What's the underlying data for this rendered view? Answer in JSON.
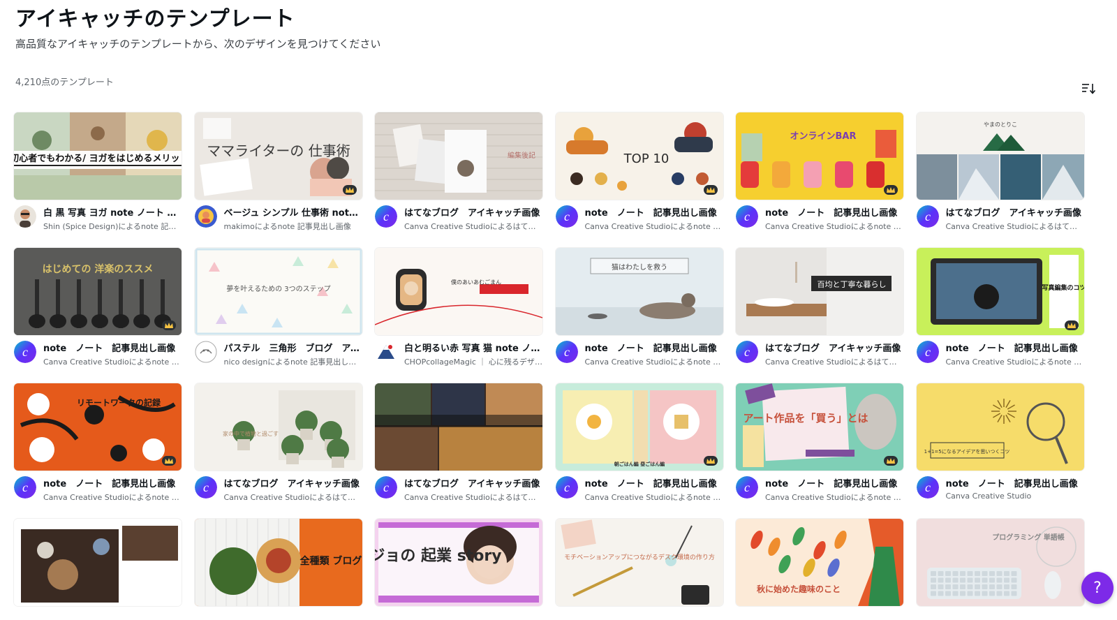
{
  "header": {
    "title": "アイキャッチのテンプレート",
    "subtitle": "高品質なアイキャッチのテンプレートから、次のデザインを見つけてください",
    "count": "4,210点のテンプレート",
    "sort_icon": "sort-icon"
  },
  "help": {
    "label": "?"
  },
  "templates": [
    {
      "title": "白 黒 写真 ヨガ note ノート 記事見出し画像",
      "author": "Shin (Spice Design)によるnote 記事見出し画像",
      "thumb_text": "\\初心者でもわかる/ ヨガをはじめるメリット",
      "avatar": "person",
      "crown": false
    },
    {
      "title": "ベージュ シンプル 仕事術 note 記事見出し画像",
      "author": "makimoによるnote 記事見出し画像",
      "thumb_text": "ママライターの 仕事術",
      "avatar": "creator",
      "crown": true
    },
    {
      "title": "はてなブログ　アイキャッチ画像",
      "author": "Canva Creative Studioによるはてなブログ",
      "thumb_text": "編集後記",
      "avatar": "canva",
      "crown": false
    },
    {
      "title": "note　ノート　記事見出し画像",
      "author": "Canva Creative Studioによるnote 記事見出し画像",
      "thumb_text": "TOP 10",
      "avatar": "canva",
      "crown": true
    },
    {
      "title": "note　ノート　記事見出し画像",
      "author": "Canva Creative Studioによるnote 記事見出し画像",
      "thumb_text": "オンラインBAR",
      "avatar": "canva",
      "crown": true
    },
    {
      "title": "はてなブログ　アイキャッチ画像",
      "author": "Canva Creative Studioによるはてなブログ",
      "thumb_text": "やまのとりこ",
      "avatar": "canva",
      "crown": false
    },
    {
      "title": "note　ノート　記事見出し画像",
      "author": "Canva Creative Studioによるnote 記事見出し画像",
      "thumb_text": "はじめての 洋楽のススメ",
      "avatar": "canva",
      "crown": true
    },
    {
      "title": "パステル　三角形　ブログ　アイキャッチ",
      "author": "nico designによるnote 記事見出し画像",
      "thumb_text": "夢を叶えるための 3つのステップ",
      "avatar": "nico",
      "crown": false
    },
    {
      "title": "白と明るい赤 写真 猫 note ノート 記事見出し画像",
      "author": "CHOPcollageMagic ｜ 心に残るデザイン",
      "thumb_text": "僕のあいあむごまん",
      "avatar": "chop",
      "crown": false
    },
    {
      "title": "note　ノート　記事見出し画像",
      "author": "Canva Creative Studioによるnote 記事見出し画像",
      "thumb_text": "猫はわたしを救う",
      "avatar": "canva",
      "crown": false
    },
    {
      "title": "はてなブログ　アイキャッチ画像",
      "author": "Canva Creative Studioによるはてなブログ",
      "thumb_text": "百均と丁寧な暮らし",
      "avatar": "canva",
      "crown": false
    },
    {
      "title": "note　ノート　記事見出し画像",
      "author": "Canva Creative Studioによるnote 記事見出し画像",
      "thumb_text": "写真編集のコツ",
      "avatar": "canva",
      "crown": true
    },
    {
      "title": "note　ノート　記事見出し画像",
      "author": "Canva Creative Studioによるnote 記事見出し画像",
      "thumb_text": "リモートワークの記録",
      "avatar": "canva",
      "crown": true
    },
    {
      "title": "はてなブログ　アイキャッチ画像",
      "author": "Canva Creative Studioによるはてなブログ",
      "thumb_text": "家の中で植物と過ごす",
      "avatar": "canva",
      "crown": false
    },
    {
      "title": "はてなブログ　アイキャッチ画像",
      "author": "Canva Creative Studioによるはてなブログ",
      "thumb_text": "",
      "avatar": "canva",
      "crown": false
    },
    {
      "title": "note　ノート　記事見出し画像",
      "author": "Canva Creative Studioによるnote 記事見出し画像",
      "thumb_text": "朝ごはん編 昼ごはん編",
      "avatar": "canva",
      "crown": true
    },
    {
      "title": "note　ノート　記事見出し画像",
      "author": "Canva Creative Studioによるnote 記事見出し画像",
      "thumb_text": "アート作品を「買う」とは",
      "avatar": "canva",
      "crown": true
    },
    {
      "title": "note　ノート　記事見出し画像",
      "author": "Canva Creative Studio",
      "thumb_text": "1+1=5になるアイデアを思いつくコツ",
      "avatar": "canva",
      "crown": false
    },
    {
      "title": "",
      "author": "",
      "thumb_text": "",
      "avatar": "",
      "crown": false
    },
    {
      "title": "",
      "author": "",
      "thumb_text": "全種類 ブログ",
      "avatar": "",
      "crown": false
    },
    {
      "title": "",
      "author": "",
      "thumb_text": "カノジョの 起業 story",
      "avatar": "",
      "crown": false
    },
    {
      "title": "",
      "author": "",
      "thumb_text": "モチベーションアップにつながるデスク環境の作り方",
      "avatar": "",
      "crown": false
    },
    {
      "title": "",
      "author": "",
      "thumb_text": "秋に始めた趣味のこと",
      "avatar": "",
      "crown": false
    },
    {
      "title": "",
      "author": "",
      "thumb_text": "プログラミング 単語帳",
      "avatar": "",
      "crown": false
    }
  ],
  "colors": {
    "canva_blue": "#1a73e8",
    "canva_purple": "#7d2ae8",
    "crown": "#f6c343"
  }
}
